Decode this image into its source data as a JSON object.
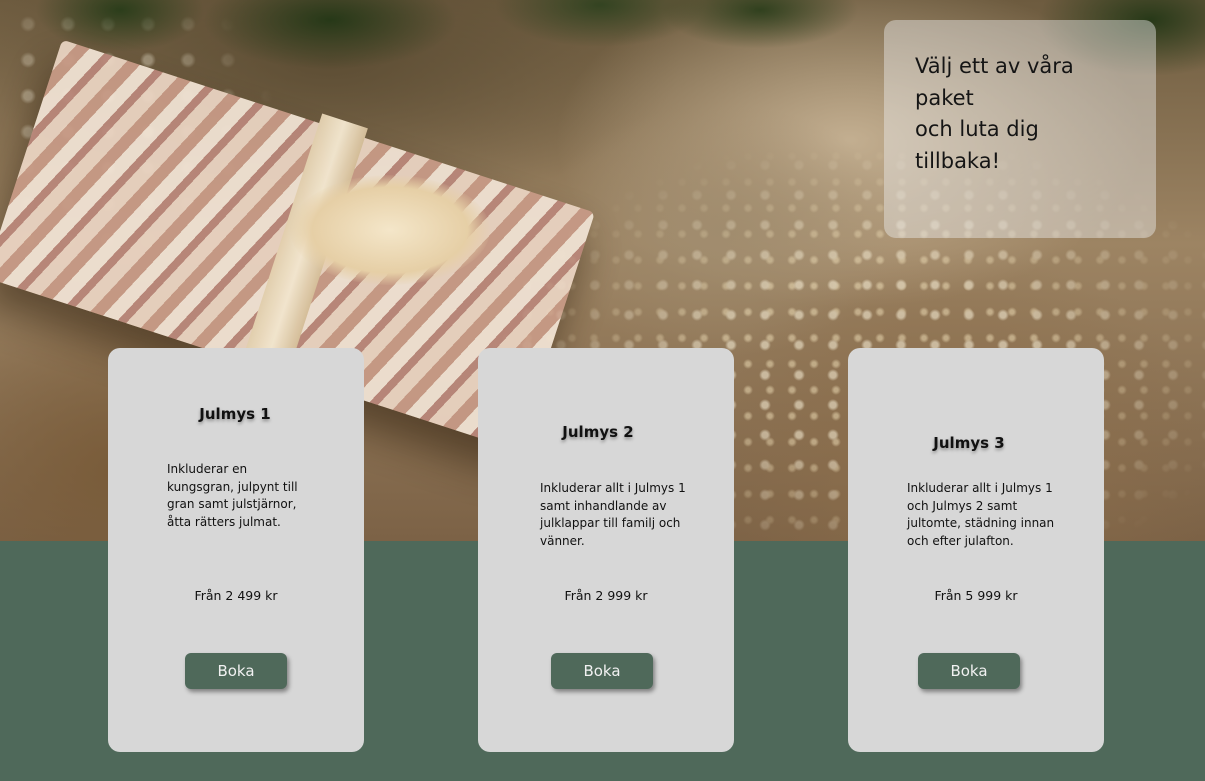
{
  "hero": {
    "image_alt": "christmas-gift-under-tree-photo"
  },
  "tagline": {
    "text": "Välj ett av våra paket\noch luta dig tillbaka!"
  },
  "packages": [
    {
      "title": "Julmys 1",
      "description": "Inkluderar en kungsgran, julpynt till gran samt julstjärnor, åtta rätters julmat.",
      "price": "Från 2 499 kr",
      "button_label": "Boka"
    },
    {
      "title": "Julmys 2",
      "description": "Inkluderar allt i Julmys 1 samt inhandlande av julklappar till familj och vänner.",
      "price": "Från 2 999 kr",
      "button_label": "Boka"
    },
    {
      "title": "Julmys 3",
      "description": "Inkluderar allt i Julmys 1 och Julmys 2 samt jultomte, städning innan och efter julafton.",
      "price": "Från 5 999 kr",
      "button_label": "Boka"
    }
  ],
  "colors": {
    "background_green": "#4f695a",
    "card_gray": "#d7d7d7",
    "button_green": "#4f695a"
  }
}
